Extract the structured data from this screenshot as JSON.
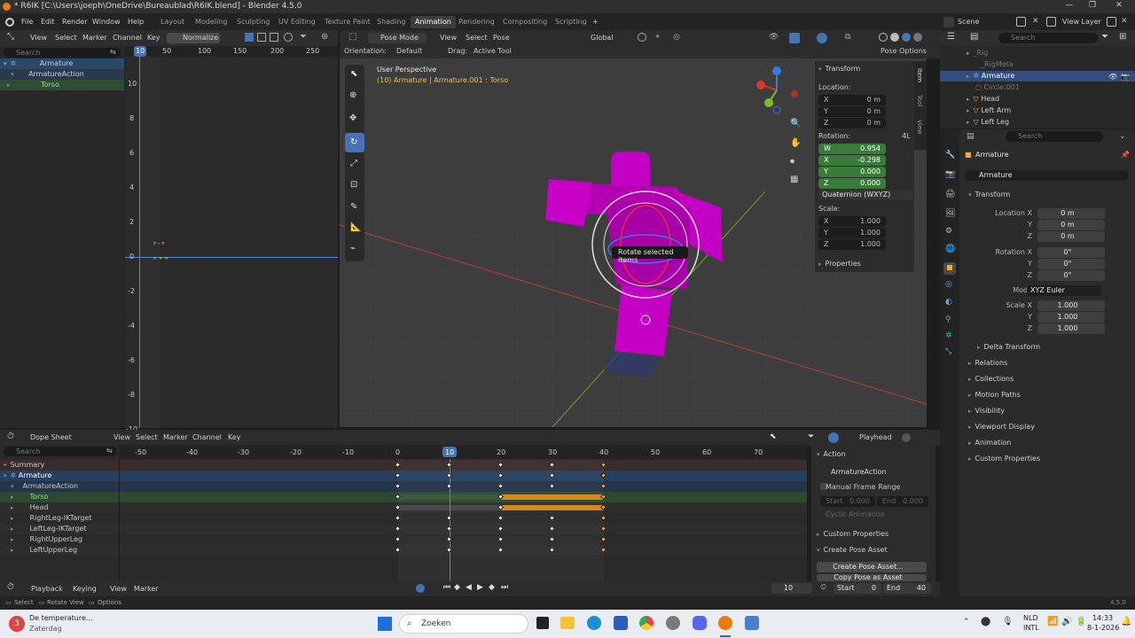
{
  "window": {
    "title": "* R6IK [C:\\Users\\joeph\\OneDrive\\Bureaublad\\R6IK.blend] - Blender 4.5.0",
    "controls": [
      "—",
      "❐",
      "✕"
    ]
  },
  "menubar": {
    "items": [
      "File",
      "Edit",
      "Render",
      "Window",
      "Help"
    ],
    "workspaces": [
      "Layout",
      "Modeling",
      "Sculpting",
      "UV Editing",
      "Texture Paint",
      "Shading",
      "Animation",
      "Rendering",
      "Compositing",
      "Scripting"
    ],
    "active_workspace": "Animation",
    "add_tab": "+",
    "scene": "Scene",
    "view_layer": "View Layer"
  },
  "graph_editor": {
    "menus": [
      "View",
      "Select",
      "Marker",
      "Channel",
      "Key"
    ],
    "normalize": "Normalize",
    "search_placeholder": "Search",
    "frame_ticks": [
      "10",
      "50",
      "100",
      "150",
      "200",
      "250"
    ],
    "y_ticks": [
      "10",
      "8",
      "6",
      "4",
      "2",
      "0",
      "-2",
      "-4",
      "-6",
      "-8",
      "-10"
    ],
    "channels": [
      "Armature",
      "ArmatureAction",
      "Torso"
    ]
  },
  "viewport": {
    "mode": "Pose Mode",
    "menus": [
      "View",
      "Select",
      "Pose"
    ],
    "orientation_label": "Orientation:",
    "orientation": "Default",
    "drag_label": "Drag:",
    "drag": "Active Tool",
    "transform_orientation": "Global",
    "pose_options": "Pose Options",
    "view_name": "User Perspective",
    "object_info": "(10) Armature | Armature.001 : Torso",
    "tooltip": "Rotate selected items",
    "side_tabs": [
      "Item",
      "Tool",
      "View"
    ],
    "n_panel": {
      "title": "Transform",
      "location_label": "Location:",
      "location": {
        "x": "0 m",
        "y": "0 m",
        "z": "0 m"
      },
      "rotation_label": "Rotation:",
      "rotation_mode_tag": "4L",
      "rotation": {
        "w": "0.954",
        "x": "-0.298",
        "y": "0.000",
        "z": "0.000"
      },
      "rotation_mode": "Quaternion (WXYZ)",
      "scale_label": "Scale:",
      "scale": {
        "x": "1.000",
        "y": "1.000",
        "z": "1.000"
      },
      "properties": "Properties"
    }
  },
  "outliner": {
    "search_placeholder": "Search",
    "items": [
      "_Rig",
      "_RigMeta",
      "Armature",
      "Circle.001",
      "Head",
      "Left Arm",
      "Left Leg"
    ]
  },
  "properties": {
    "search_placeholder": "Search",
    "object_name": "Armature",
    "object_field": "Armature",
    "transform_title": "Transform",
    "location_x_label": "Location X",
    "location": [
      "0 m",
      "0 m",
      "0 m"
    ],
    "rotation_x_label": "Rotation X",
    "rotation": [
      "0°",
      "0°",
      "0°"
    ],
    "mode_label": "Mode",
    "mode": "XYZ Euler",
    "scale_x_label": "Scale X",
    "scale": [
      "1.000",
      "1.000",
      "1.000"
    ],
    "axis_y": "Y",
    "axis_z": "Z",
    "delta_transform": "Delta Transform",
    "sections": [
      "Relations",
      "Collections",
      "Motion Paths",
      "Visibility",
      "Viewport Display",
      "Animation",
      "Custom Properties"
    ]
  },
  "dopesheet": {
    "mode": "Dope Sheet",
    "menus": [
      "View",
      "Select",
      "Marker",
      "Channel",
      "Key"
    ],
    "search_placeholder": "Search",
    "frame_ticks": [
      "-50",
      "-40",
      "-30",
      "-20",
      "-10",
      "0",
      "10",
      "20",
      "30",
      "40",
      "50",
      "60",
      "70"
    ],
    "current_frame": "10",
    "channels": [
      "Summary",
      "Armature",
      "ArmatureAction",
      "Torso",
      "Head",
      "RightLeg-IKTarget",
      "LeftLeg-IKTarget",
      "RightUpperLeg",
      "LeftUpperLeg"
    ],
    "playhead": "Playhead",
    "side_panel": {
      "action_title": "Action",
      "action_name": "ArmatureAction",
      "manual_frame_range": "Manual Frame Range",
      "start": "Start",
      "start_value": "0.000",
      "end": "End",
      "end_value": "0.000",
      "cyclic": "Cyclic Animation",
      "custom_properties": "Custom Properties",
      "create_pose_asset": "Create Pose Asset",
      "create_pose_asset_btn": "Create Pose Asset...",
      "copy_pose_asset_btn": "Copy Pose as Asset"
    }
  },
  "timeline": {
    "menus": [
      "Playback",
      "Keying",
      "View",
      "Marker"
    ],
    "current_frame": "10",
    "start_label": "Start",
    "start": "0",
    "end_label": "End",
    "end": "40"
  },
  "statusbar": {
    "select": "Select",
    "rotate_view": "Rotate View",
    "options": "Options",
    "version": "4.5.0"
  },
  "taskbar": {
    "weather_title": "De temperature...",
    "weather_sub": "Zaterdag",
    "weather_badge": "3",
    "search": "Zoeken",
    "lang": "NLD",
    "lang_sub": "INTL",
    "time": "14:33",
    "date": "8-1-2026"
  }
}
